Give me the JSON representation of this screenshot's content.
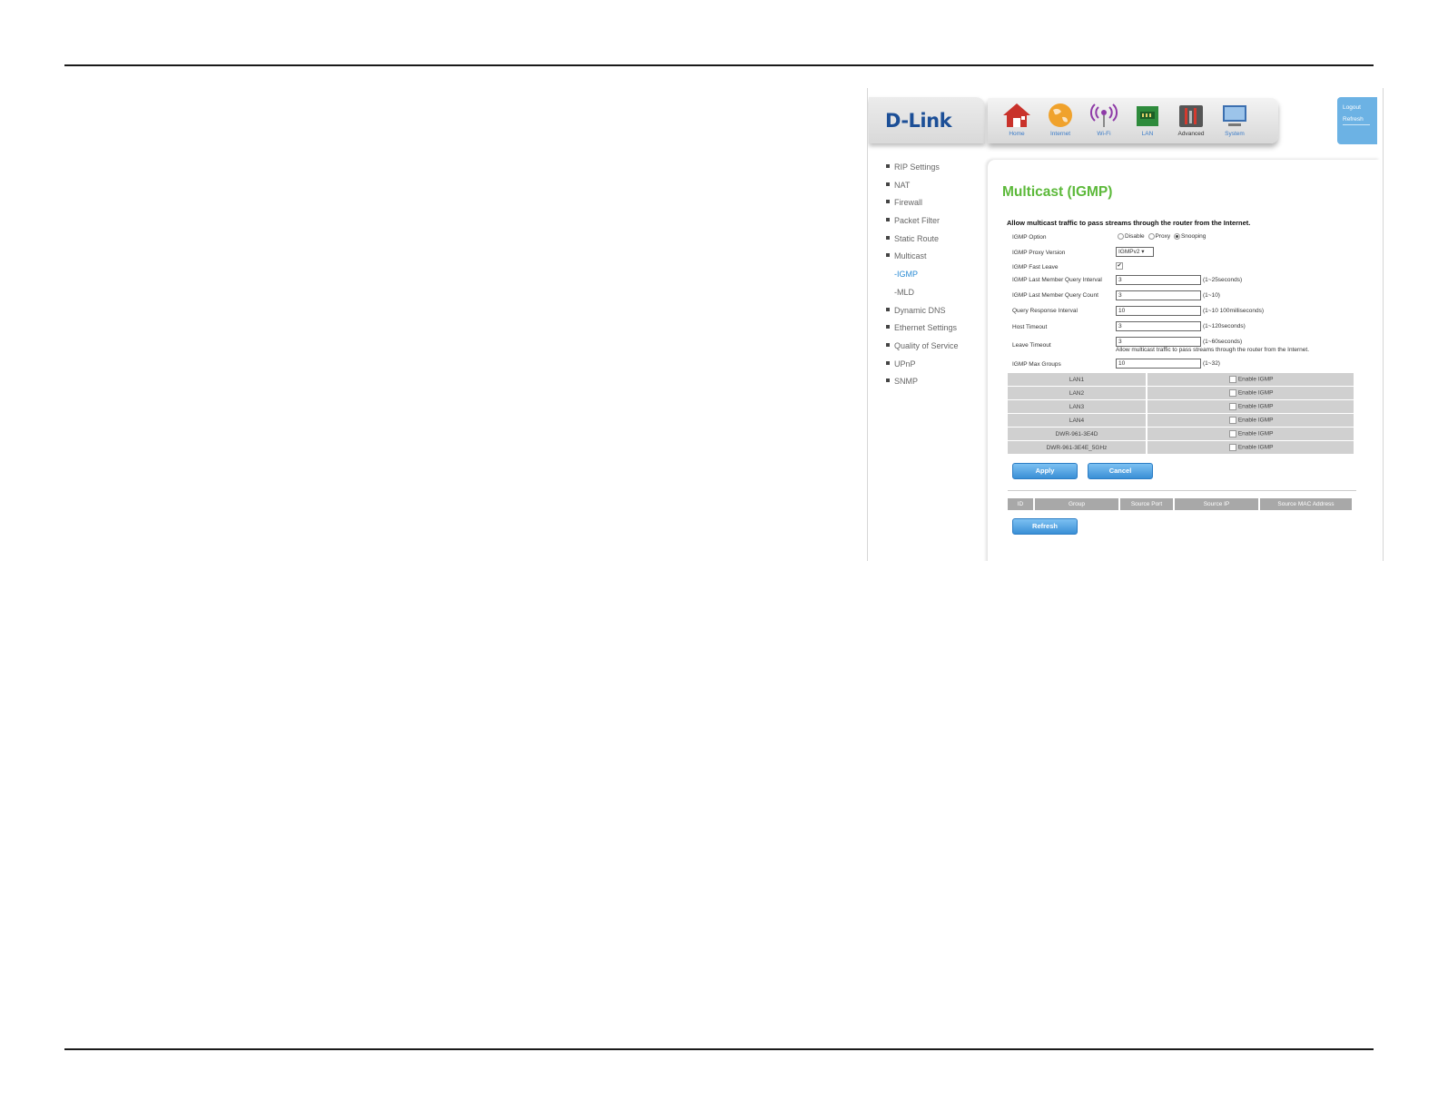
{
  "header": {
    "logo": "D-Link",
    "nav": [
      {
        "label": "Home",
        "icon": "home-icon"
      },
      {
        "label": "Internet",
        "icon": "globe-icon"
      },
      {
        "label": "Wi-Fi",
        "icon": "wifi-icon"
      },
      {
        "label": "LAN",
        "icon": "lan-icon"
      },
      {
        "label": "Advanced",
        "icon": "tools-icon"
      },
      {
        "label": "System",
        "icon": "monitor-icon"
      }
    ],
    "logout": "Logout",
    "refresh": "Refresh"
  },
  "sidebar": {
    "items": [
      {
        "label": "RIP Settings"
      },
      {
        "label": "NAT"
      },
      {
        "label": "Firewall"
      },
      {
        "label": "Packet Filter"
      },
      {
        "label": "Static Route"
      },
      {
        "label": "Multicast"
      },
      {
        "label": "-IGMP"
      },
      {
        "label": "-MLD"
      },
      {
        "label": "Dynamic DNS"
      },
      {
        "label": "Ethernet Settings"
      },
      {
        "label": "Quality of Service"
      },
      {
        "label": "UPnP"
      },
      {
        "label": "SNMP"
      }
    ]
  },
  "main": {
    "title": "Multicast (IGMP)",
    "intro": "Allow multicast traffic to pass streams through the router from the Internet.",
    "igmp_option": {
      "label": "IGMP Option",
      "opt1": "Disable",
      "opt2": "Proxy",
      "opt3": "Snooping"
    },
    "proxy_version": {
      "label": "IGMP Proxy Version",
      "value": "IGMPv2"
    },
    "fast_leave": {
      "label": "IGMP Fast Leave",
      "mark": "✔"
    },
    "fields": [
      {
        "label": "IGMP Last Member Query Interval",
        "value": "3",
        "hint": "(1~25seconds)"
      },
      {
        "label": "IGMP Last Member Query Count",
        "value": "3",
        "hint": "(1~10)"
      },
      {
        "label": "Query Response Interval",
        "value": "10",
        "hint": "(1~10 100milliseconds)"
      },
      {
        "label": "Host Timeout",
        "value": "3",
        "hint": "(1~120seconds)"
      },
      {
        "label": "Leave Timeout",
        "value": "3",
        "hint": "(1~60seconds)",
        "note": "Allow multicast traffic to pass streams through the router from the Internet."
      },
      {
        "label": "IGMP Max Groups",
        "value": "10",
        "hint": "(1~32)"
      }
    ],
    "lan_rows": [
      {
        "name": "LAN1",
        "option": "Enable IGMP"
      },
      {
        "name": "LAN2",
        "option": "Enable IGMP"
      },
      {
        "name": "LAN3",
        "option": "Enable IGMP"
      },
      {
        "name": "LAN4",
        "option": "Enable IGMP"
      },
      {
        "name": "DWR-961-3E4D",
        "option": "Enable IGMP"
      },
      {
        "name": "DWR-961-3E4E_5GHz",
        "option": "Enable IGMP"
      }
    ],
    "apply": "Apply",
    "cancel": "Cancel",
    "group_table": {
      "headers": [
        "ID",
        "Group",
        "Source Port",
        "Source IP",
        "Source MAC Address"
      ]
    },
    "refresh": "Refresh"
  }
}
